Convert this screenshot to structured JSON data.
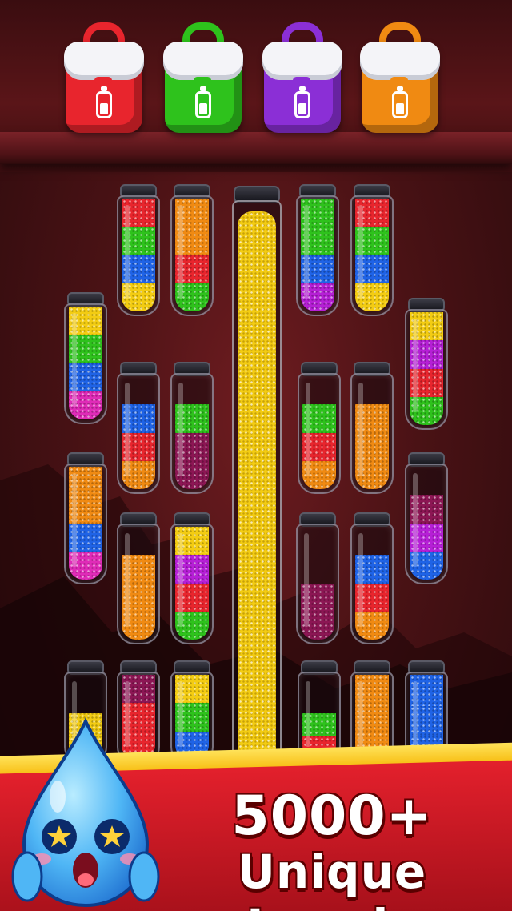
{
  "headline": {
    "line1": "5000+",
    "line2": "Unique Levels"
  },
  "colors": {
    "red": "#e8252d",
    "green": "#2ec21c",
    "blue": "#1f63e6",
    "yellow": "#f3cc12",
    "orange": "#f08a12",
    "purple": "#b61fd6",
    "magenta": "#e02bb8",
    "maroon": "#8c1654",
    "banner_red": "#d4161f",
    "banner_gold": "#ffd23a"
  },
  "bags": [
    {
      "name": "red-bag",
      "color": "#e8252d",
      "icon": "bottle-icon"
    },
    {
      "name": "green-bag",
      "color": "#2ec21c",
      "icon": "bottle-icon"
    },
    {
      "name": "purple-bag",
      "color": "#8b2fd6",
      "icon": "bottle-icon"
    },
    {
      "name": "orange-bag",
      "color": "#f08a12",
      "icon": "bottle-icon"
    }
  ],
  "tubes": [
    {
      "layers": [
        "yellow",
        "blue",
        "green",
        "red"
      ]
    },
    {
      "layers": [
        "green",
        "red",
        "orange",
        "orange"
      ]
    },
    {
      "layers": [
        "purple",
        "blue",
        "green",
        "green"
      ]
    },
    {
      "layers": [
        "yellow",
        "blue",
        "green",
        "red"
      ]
    },
    {
      "layers": [
        "magenta",
        "blue",
        "green",
        "yellow"
      ]
    },
    {
      "layers": [
        "green",
        "red",
        "purple",
        "yellow"
      ]
    },
    {
      "layers": [
        "orange",
        "red",
        "blue"
      ]
    },
    {
      "layers": [
        "maroon",
        "maroon",
        "green"
      ]
    },
    {
      "layers": [
        "orange",
        "red",
        "green"
      ]
    },
    {
      "layers": [
        "orange",
        "orange",
        "orange"
      ]
    },
    {
      "layers": [
        "magenta",
        "blue",
        "orange",
        "orange"
      ]
    },
    {
      "layers": [
        "blue",
        "purple",
        "maroon"
      ]
    },
    {
      "layers": [
        "orange",
        "orange",
        "orange"
      ]
    },
    {
      "layers": [
        "green",
        "red",
        "purple",
        "yellow"
      ]
    },
    {
      "layers": [
        "maroon",
        "maroon"
      ]
    },
    {
      "layers": [
        "orange",
        "red",
        "blue"
      ]
    },
    {
      "layers": [
        "yellow",
        "yellow"
      ]
    },
    {
      "layers": [
        "red",
        "red",
        "maroon"
      ]
    },
    {
      "layers": [
        "blue",
        "green",
        "yellow"
      ]
    },
    {
      "layers": [
        "red",
        "green"
      ]
    },
    {
      "layers": [
        "orange",
        "orange",
        "orange"
      ]
    },
    {
      "layers": [
        "blue",
        "blue",
        "blue"
      ]
    }
  ],
  "big_tube": {
    "color": "yellow"
  },
  "mascot": {
    "name": "water-drop-mascot",
    "color": "#4fb6f5"
  }
}
